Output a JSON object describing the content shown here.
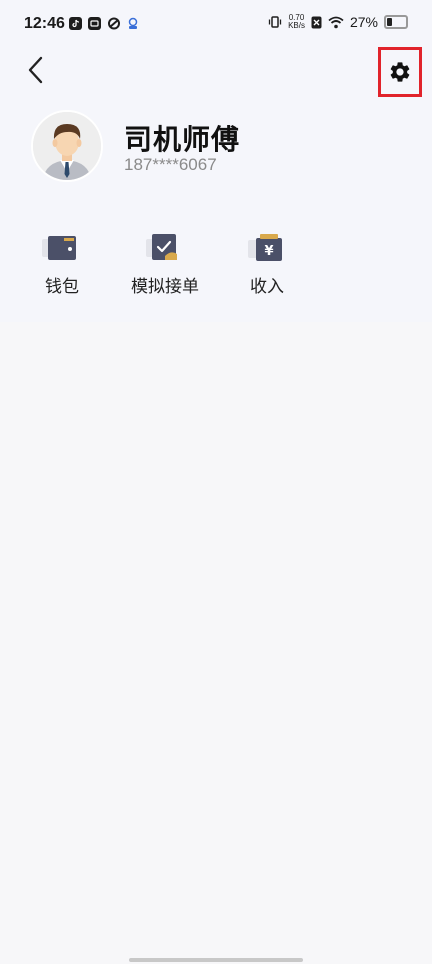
{
  "status_bar": {
    "time": "12:46",
    "net_speed_value": "0.70",
    "net_speed_unit": "KB/s",
    "battery": "27%"
  },
  "profile": {
    "name": "司机师傅",
    "phone": "187****6067"
  },
  "actions": [
    {
      "label": "钱包",
      "icon": "wallet-icon"
    },
    {
      "label": "模拟接单",
      "icon": "simulate-order-icon"
    },
    {
      "label": "收入",
      "icon": "income-icon"
    }
  ],
  "colors": {
    "highlight_border": "#e1232b",
    "icon_dark": "#4b5068",
    "icon_accent": "#d9a94c"
  }
}
